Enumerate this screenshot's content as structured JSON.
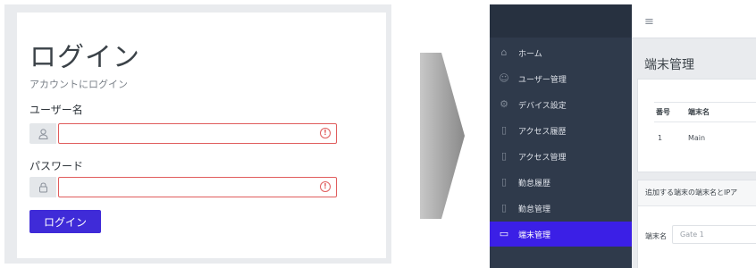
{
  "login": {
    "title": "ログイン",
    "subtitle": "アカウントにログイン",
    "username_label": "ユーザー名",
    "password_label": "パスワード",
    "button_label": "ログイン",
    "username_value": "",
    "password_value": ""
  },
  "admin": {
    "menu_icon": "≡",
    "sidebar": {
      "items": [
        {
          "label": "ホーム",
          "icon": "home-icon"
        },
        {
          "label": "ユーザー管理",
          "icon": "user-icon"
        },
        {
          "label": "デバイス設定",
          "icon": "gear-icon"
        },
        {
          "label": "アクセス履歴",
          "icon": "book-icon"
        },
        {
          "label": "アクセス管理",
          "icon": "book-icon"
        },
        {
          "label": "勤怠履歴",
          "icon": "book-icon"
        },
        {
          "label": "勤怠管理",
          "icon": "book-icon"
        },
        {
          "label": "端末管理",
          "icon": "monitor-icon"
        }
      ],
      "active_index": 7
    },
    "page_title": "端末管理",
    "table": {
      "headers": [
        "番号",
        "端末名",
        "端"
      ],
      "rows": [
        [
          "1",
          "Main",
          ":"
        ]
      ]
    },
    "form": {
      "heading": "追加する端末の端末名とIPア",
      "label": "端末名",
      "placeholder": "Gate 1"
    }
  },
  "colors": {
    "accent": "#3f2bd8",
    "sidebar_bg": "#2f3a4b",
    "error": "#e05c5c"
  }
}
